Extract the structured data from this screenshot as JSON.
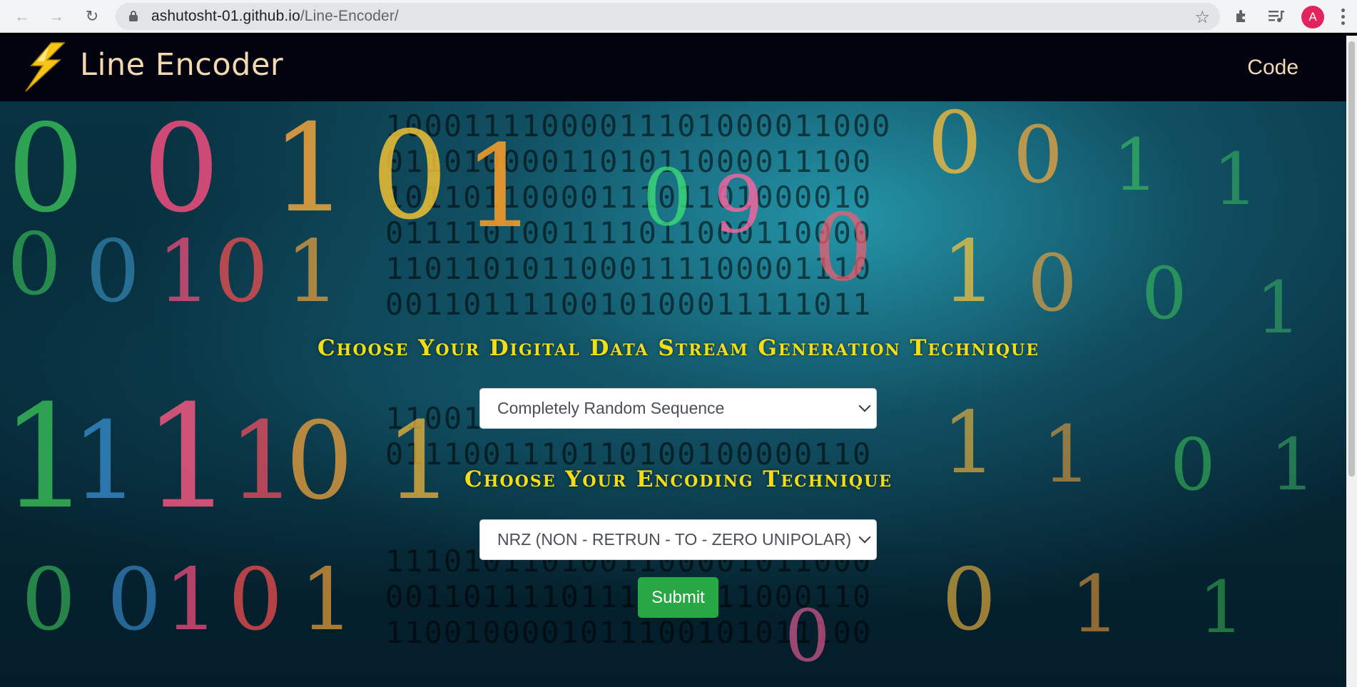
{
  "browser": {
    "url_domain": "ashutosht-01.github.io",
    "url_path": "/Line-Encoder/",
    "avatar_letter": "A",
    "icons": [
      "back-arrow-icon",
      "forward-arrow-icon",
      "reload-icon",
      "lock-icon",
      "star-icon",
      "puzzle-icon",
      "media-control-icon",
      "kebab-menu-icon"
    ]
  },
  "navbar": {
    "brand": "Line Encoder",
    "code_link": "Code",
    "logo_icon": "lightning-bolt-icon"
  },
  "form": {
    "data_stream_heading": "Choose Your Digital Data Stream Generation Technique",
    "data_stream_selected": "Completely Random Sequence",
    "encoding_heading": "Choose Your Encoding Technique",
    "encoding_selected": "NRZ (NON - RETRUN - TO - ZERO UNIPOLAR)",
    "submit_label": "Submit"
  },
  "colors": {
    "navbar_bg": "#03030f",
    "brand_text": "#f4d9b0",
    "heading_yellow": "#f2dd17",
    "submit_green": "#28a745"
  }
}
